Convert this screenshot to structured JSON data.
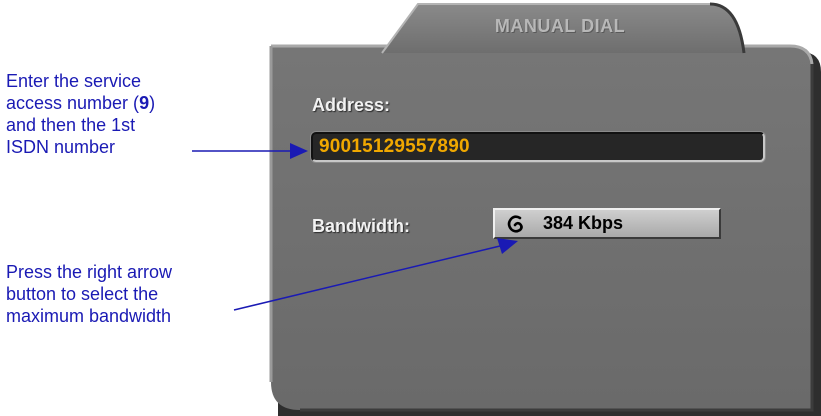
{
  "dialog": {
    "title": "MANUAL DIAL",
    "address_label": "Address:",
    "address_value": "90015129557890",
    "bandwidth_label": "Bandwidth:",
    "bandwidth_value": "384 Kbps",
    "bandwidth_icon": "spiral-icon"
  },
  "annotations": {
    "callout_1": {
      "line1": "Enter the service",
      "line2_prefix": "access number (",
      "line2_bold": "9",
      "line2_suffix": ")",
      "line3": "and then the 1st",
      "line4": "ISDN number"
    },
    "callout_2": {
      "line1": "Press the right arrow",
      "line2": "button to select the",
      "line3": "maximum bandwidth"
    }
  },
  "colors": {
    "panel": "#6e6e6e",
    "field_text": "#f0a800",
    "label_text": "#f2f2f2",
    "annotation_text": "#1a1ab4"
  }
}
